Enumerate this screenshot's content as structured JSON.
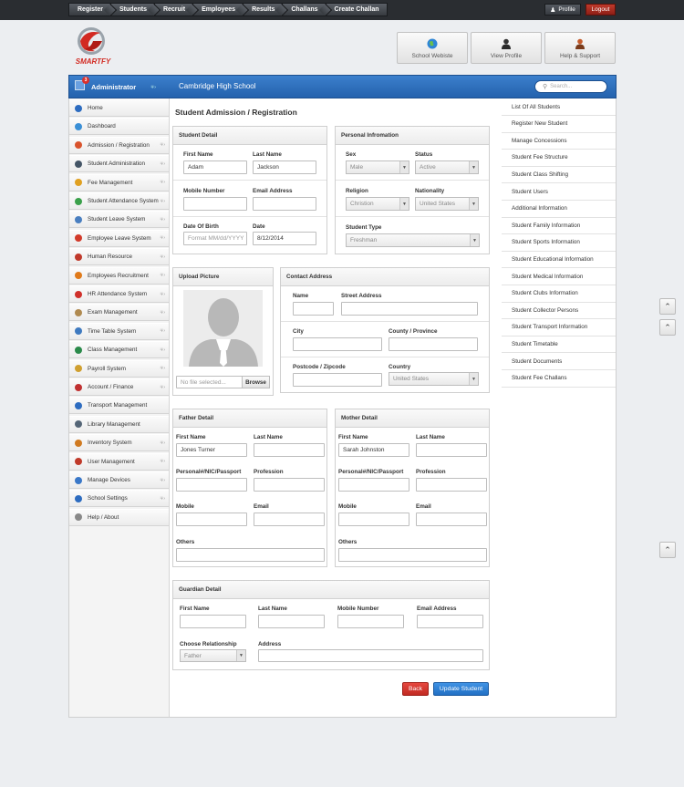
{
  "topnav": {
    "items": [
      "Register",
      "Students",
      "Recruit",
      "Employees",
      "Results",
      "Challans",
      "Create Challan"
    ],
    "profile_label": "Profile",
    "logout_label": "Logout"
  },
  "brand": {
    "logo_text": "SMARTFY"
  },
  "header_buttons": [
    {
      "label": "School Webiste",
      "icon": "globe-icon"
    },
    {
      "label": "View Profile",
      "icon": "user-icon"
    },
    {
      "label": "Help & Support",
      "icon": "support-icon"
    }
  ],
  "header": {
    "admin_title": "Administrator",
    "notification_count": "3",
    "school_name": "Cambridge High School",
    "search_placeholder": "Search..."
  },
  "sidebar": {
    "items": [
      {
        "label": "Home",
        "icon": "home-icon",
        "color": "#2d6cc0",
        "arrow": false
      },
      {
        "label": "Dashboard",
        "icon": "dashboard-icon",
        "color": "#3a8fd6",
        "arrow": false
      },
      {
        "label": "Admission / Registration",
        "icon": "admission-icon",
        "color": "#d9532c",
        "arrow": true
      },
      {
        "label": "Student Administration",
        "icon": "student-admin-icon",
        "color": "#445566",
        "arrow": true
      },
      {
        "label": "Fee Management",
        "icon": "fee-icon",
        "color": "#e0a020",
        "arrow": true
      },
      {
        "label": "Student Attendance System",
        "icon": "attendance-icon",
        "color": "#3aa04a",
        "arrow": true
      },
      {
        "label": "Student Leave System",
        "icon": "leave-icon",
        "color": "#4a7fc0",
        "arrow": true
      },
      {
        "label": "Employee Leave System",
        "icon": "employee-leave-icon",
        "color": "#d23a2a",
        "arrow": true
      },
      {
        "label": "Human Resource",
        "icon": "hr-icon",
        "color": "#c0392b",
        "arrow": true
      },
      {
        "label": "Employees Recruitment",
        "icon": "recruit-icon",
        "color": "#e07a1a",
        "arrow": true
      },
      {
        "label": "HR Attendance System",
        "icon": "hr-attendance-icon",
        "color": "#d0302a",
        "arrow": true
      },
      {
        "label": "Exam Management",
        "icon": "exam-icon",
        "color": "#b08a50",
        "arrow": true
      },
      {
        "label": "Time Table System",
        "icon": "timetable-icon",
        "color": "#3f7ac0",
        "arrow": true
      },
      {
        "label": "Class Management",
        "icon": "class-icon",
        "color": "#2a8a4a",
        "arrow": true
      },
      {
        "label": "Payroll System",
        "icon": "payroll-icon",
        "color": "#d0a030",
        "arrow": true
      },
      {
        "label": "Account / Finance",
        "icon": "finance-icon",
        "color": "#c03030",
        "arrow": true
      },
      {
        "label": "Transport Management",
        "icon": "transport-icon",
        "color": "#2d6cc0",
        "arrow": false
      },
      {
        "label": "Library Management",
        "icon": "library-icon",
        "color": "#556677",
        "arrow": false
      },
      {
        "label": "Inventory System",
        "icon": "inventory-icon",
        "color": "#d07a20",
        "arrow": true
      },
      {
        "label": "User Management",
        "icon": "user-mgmt-icon",
        "color": "#c03a2a",
        "arrow": true
      },
      {
        "label": "Manage Devices",
        "icon": "devices-icon",
        "color": "#3a78c8",
        "arrow": true
      },
      {
        "label": "School Settings",
        "icon": "settings-icon",
        "color": "#2d6cc0",
        "arrow": true
      },
      {
        "label": "Help / About",
        "icon": "help-icon",
        "color": "#888888",
        "arrow": false
      }
    ]
  },
  "page_title": "Student Admission / Registration",
  "student_detail": {
    "title": "Student Detail",
    "first_name_label": "First Name",
    "first_name_value": "Adam",
    "last_name_label": "Last Name",
    "last_name_value": "Jackson",
    "mobile_label": "Mobile Number",
    "mobile_value": "",
    "email_label": "Email Address",
    "email_value": "",
    "dob_label": "Date Of Birth",
    "dob_placeholder": "Format MM/dd/YYYY",
    "date_label": "Date",
    "date_value": "8/12/2014"
  },
  "personal_info": {
    "title": "Personal Infromation",
    "sex_label": "Sex",
    "sex_value": "Male",
    "status_label": "Status",
    "status_value": "Active",
    "religion_label": "Religion",
    "religion_value": "Christion",
    "nationality_label": "Nationality",
    "nationality_value": "United States",
    "student_type_label": "Student Type",
    "student_type_value": "Freshman"
  },
  "upload_picture": {
    "title": "Upload Picture",
    "file_placeholder": "No file selected...",
    "browse_label": "Browse"
  },
  "contact_address": {
    "title": "Contact Address",
    "name_label": "Name",
    "street_label": "Street Address",
    "city_label": "City",
    "county_label": "County / Province",
    "postcode_label": "Postcode / Zipcode",
    "country_label": "Country",
    "country_value": "United States"
  },
  "father_detail": {
    "title": "Father Detail",
    "first_name_label": "First Name",
    "first_name_value": "Jones Turner",
    "last_name_label": "Last Name",
    "nic_label": "Personal#/NIC/Passport",
    "profession_label": "Profession",
    "mobile_label": "Mobile",
    "email_label": "Email",
    "others_label": "Others"
  },
  "mother_detail": {
    "title": "Mother Detail",
    "first_name_label": "First Name",
    "first_name_value": "Sarah Johnston",
    "last_name_label": "Last Name",
    "nic_label": "Personal#/NIC/Passport",
    "profession_label": "Profession",
    "mobile_label": "Mobile",
    "email_label": "Email",
    "others_label": "Others"
  },
  "guardian_detail": {
    "title": "Guardian Detail",
    "first_name_label": "First Name",
    "last_name_label": "Last Name",
    "mobile_label": "Mobile Number",
    "email_label": "Email Address",
    "relationship_label": "Choose Relationship",
    "relationship_value": "Father",
    "address_label": "Address"
  },
  "actions": {
    "back_label": "Back",
    "update_label": "Update Student"
  },
  "right_menu": {
    "items": [
      "List Of All Students",
      "Register New Student",
      "Manage Concessions",
      "Student Fee Structure",
      "Student Class Shifting",
      "Student Users",
      "Additional Information",
      "Student Family Information",
      "Student Sports Information",
      "Student Educational Information",
      "Student Medical Information",
      "Student Clubs Information",
      "Student Collector Persons",
      "Student Transport Information",
      "Student Timetable",
      "Student Documents",
      "Student Fee Challans"
    ]
  },
  "colors": {
    "accent": "#2d6cc0",
    "back": "#d9302c",
    "update": "#2a7fd8"
  }
}
